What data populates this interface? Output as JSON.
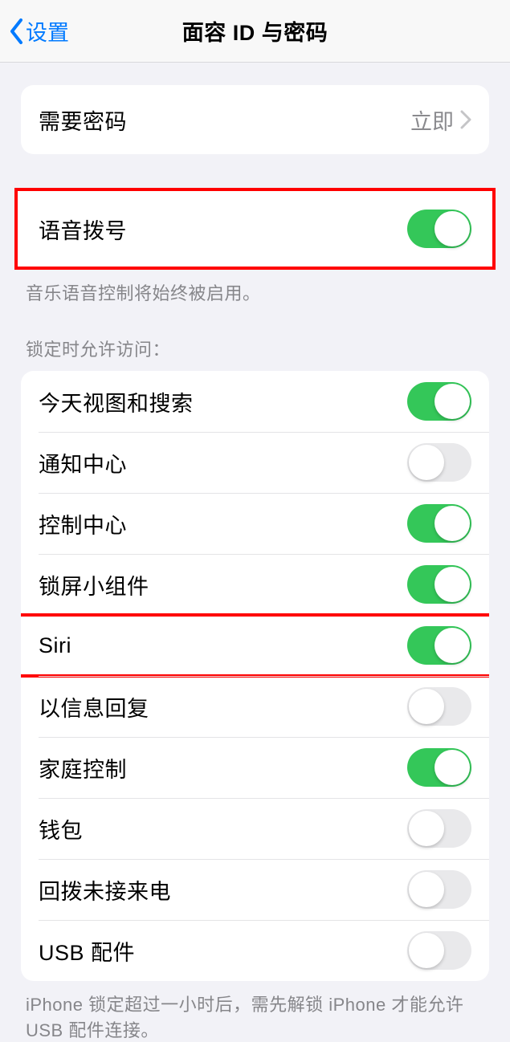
{
  "nav": {
    "back_label": "设置",
    "title": "面容 ID 与密码"
  },
  "require_passcode": {
    "label": "需要密码",
    "value": "立即"
  },
  "voice_dial": {
    "label": "语音拨号",
    "on": true,
    "footer": "音乐语音控制将始终被启用。"
  },
  "lock_header": "锁定时允许访问：",
  "lock_items": [
    {
      "label": "今天视图和搜索",
      "on": true
    },
    {
      "label": "通知中心",
      "on": false
    },
    {
      "label": "控制中心",
      "on": true
    },
    {
      "label": "锁屏小组件",
      "on": true
    },
    {
      "label": "Siri",
      "on": true
    },
    {
      "label": "以信息回复",
      "on": false
    },
    {
      "label": "家庭控制",
      "on": true
    },
    {
      "label": "钱包",
      "on": false
    },
    {
      "label": "回拨未接来电",
      "on": false
    },
    {
      "label": "USB 配件",
      "on": false
    }
  ],
  "usb_footer": "iPhone 锁定超过一小时后，需先解锁 iPhone 才能允许 USB 配件连接。"
}
